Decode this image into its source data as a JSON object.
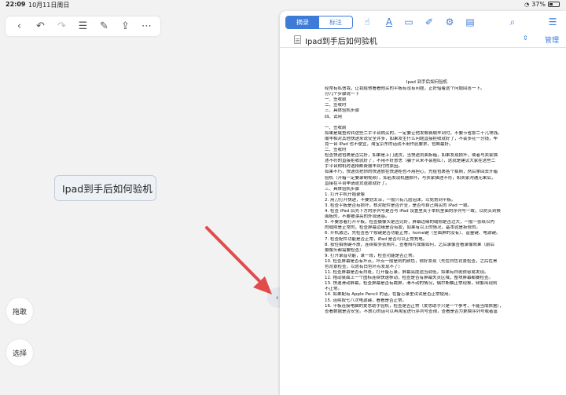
{
  "status_bar": {
    "time": "22:09",
    "date": "10月11日周日",
    "battery": "37%",
    "battery_level": 0.37
  },
  "left_toolbar": {
    "buttons": [
      {
        "name": "back",
        "glyph": "‹"
      },
      {
        "name": "undo",
        "glyph": "↶"
      },
      {
        "name": "redo",
        "glyph": "↷"
      },
      {
        "name": "outline",
        "glyph": "☰"
      },
      {
        "name": "edit",
        "glyph": "✎"
      },
      {
        "name": "share",
        "glyph": "⇪"
      },
      {
        "name": "more",
        "glyph": "⋯"
      }
    ]
  },
  "mind_node": {
    "label": "Ipad到手后如何验机"
  },
  "side_buttons": {
    "scroll": "拖敢",
    "select": "选择"
  },
  "split_handle": {
    "left": "‹",
    "right": "›"
  },
  "doc_panel": {
    "segments": [
      "摘录",
      "标注"
    ],
    "active_segment": 0,
    "tools": [
      {
        "name": "hand-icon",
        "glyph": "☝"
      },
      {
        "name": "text-icon",
        "glyph": "A"
      },
      {
        "name": "rect-icon",
        "glyph": "▭"
      },
      {
        "name": "draw-icon",
        "glyph": "✐"
      },
      {
        "name": "gear-icon",
        "glyph": "⚙"
      },
      {
        "name": "bookmark-icon",
        "glyph": "▤"
      },
      {
        "name": "search-icon",
        "glyph": "⌕"
      },
      {
        "name": "list-icon",
        "glyph": "☰"
      }
    ],
    "doc_title": "Ipad到手后如何验机",
    "manage_label": "管理",
    "updown": "⇕"
  },
  "page": {
    "title": "Ipad 到手后如何验机",
    "paras": [
      [
        "经常有私信我，让我给他看看他买的平板有没有问题，正好借着这个问题回答一下。",
        "分几个步骤说一下",
        "一、签收前",
        "二、签收时",
        "三、具体验机步骤",
        "四、试用"
      ],
      [
        "一、签收前",
        "如果是咸鱼转转这些二手平台购买的，一定要让他发邮费顺丰到付，不要节省那二十几块钱。",
        "顺丰相对其他快递来说安全许多，如果发生什么问题直接拒收就好了，不会多花一分钱，毕",
        "竟一台 iPad 也不便宜，淘宝京东的话就不用作此要求，包邮最好。",
        "二、签收时",
        "检查快递包裹是否完好，如果是上门送货，当快递员面拆箱，如果发现损坏，或者与卖家描",
        "述不符的直接拒收就好了，不用不好意思（骗子从来不会脸红），这就是建议大家在这些二",
        "手平台购机时选择邮费顺丰到付的原因。",
        "如果不巧，快递员把你的快递放在快递柜也不用担心，先给包裹各个拍照，然后拿回去开箱",
        "验机（开箱一定要录制视频），如若发现机器损坏，与卖家描述不符，和卖家沟通无果后，",
        "直接在平台申请退货退款就好了。",
        "三、具体验机步骤",
        "1.  打开手机开始录像",
        "2.  用刀打开快递，不要划太深，一般只有几层泡沫，以免划到平板。",
        "3.  检查平板是否有损坏，核对配件是否齐全，是否与自己购买的 iPad 一致。",
        "4.  检查 iPad 后壳下方的序列号是否与 iPad 设置里关于本机里面的序列号一致，以防买到换",
        "面板的，不要被漂亮的外观迷惑。",
        "5.  不要急着打开平板，检查摄像头是否完好，屏幕边缘的缝隙是否过大，一般一张纸以内",
        "的缝隙是正常的，检查屏幕边缘是否有胶，如果有以上的情况，基本就是拆修的。",
        "6.  开机激活，先检查各个按键是否功能正常，home键（全面屏的没有）、音量键、电源键。",
        "7.  检查配件功能是否正常，iPad 是否可以正常充电。",
        "8.  按住拍照键不放，连续拍多张照片，查看照片成像如何，之后录像查看录像效果（前后",
        "摄像头都需要检查）",
        "9.  打开录音功能，录一段，检查功能是否正常。",
        "10. 检查屏幕是否有坏点，坏点一般是则的颜色，很好发现（先在白色背景检查，之后在黑",
        "色背景检查，以防有白色坏点发现不了）",
        "11. 检查屏幕是否有白斑，打开备忘录，屏幕亮度适当调低，如果有白斑很容易发现。",
        "12. 拖动桌面上一个图标连续快速移动，检查是否有屏幕失灵区域，整块屏幕都要检查。",
        "13. 快速滑动屏幕，检查屏幕是否有跳屏，滑不动的情况，偶尔断触正常现象，频繁出现则",
        "不正常。",
        "14. 如果配有 Apple Pencil 的话，在备忘录里试试是否正常使用。",
        "15. 连续按七八次电源键，看看是否正常。",
        "16. 平板连接电脑的爱思助手验机，检查是否正常（爱思助手只是一个参考，不能当成依据），",
        "查看数据是否安全。不放心的话可以再淘宝进行序列号查询，查看是否为更换序列号或者富"
      ]
    ]
  }
}
